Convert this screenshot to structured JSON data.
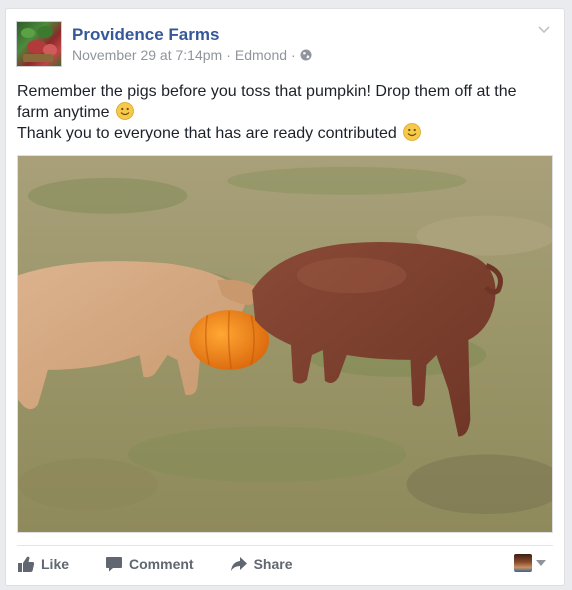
{
  "post": {
    "page_name": "Providence Farms",
    "date": "November 29 at 7:14pm",
    "separator": "·",
    "location": "Edmond",
    "text_line1": "Remember the pigs before you toss that pumpkin! Drop them off at the farm anytime",
    "text_line2": "Thank you to everyone that has are ready contributed"
  },
  "actions": {
    "like_label": "Like",
    "comment_label": "Comment",
    "share_label": "Share"
  },
  "icons": {
    "avatar": "farm-logo",
    "audience": "globe-icon",
    "menu": "chevron-down-icon",
    "emoji": "smiley-emoji",
    "like": "thumbs-up-icon",
    "comment": "comment-icon",
    "share": "share-arrow-icon"
  },
  "colors": {
    "link_blue": "#365899",
    "meta_gray": "#90949c",
    "action_gray": "#606770"
  }
}
